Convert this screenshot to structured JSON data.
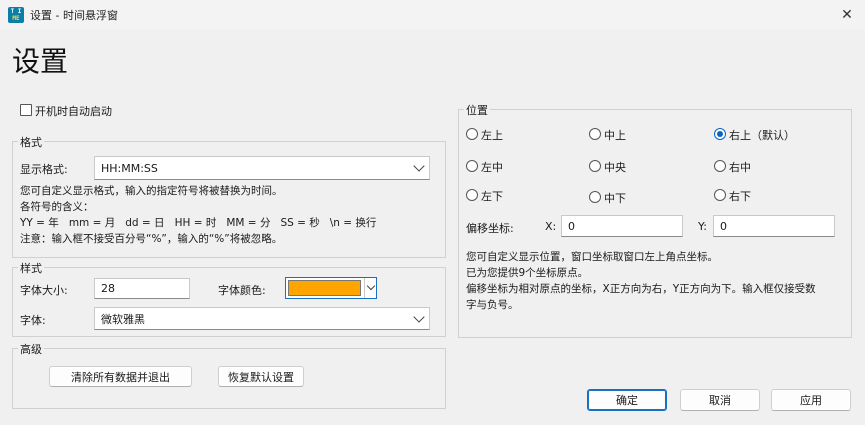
{
  "window": {
    "title": "设置 - 时间悬浮窗",
    "icon_text_top": "T I",
    "icon_text_bottom": "ME"
  },
  "page_title": "设置",
  "autostart": {
    "label": "开机时自动启动",
    "checked": false
  },
  "format_group": {
    "title": "格式",
    "display_label": "显示格式:",
    "display_value": "HH:MM:SS",
    "desc": [
      "您可自定义显示格式，输入的指定符号将被替换为时间。",
      "各符号的含义：",
      "YY = 年   mm = 月   dd = 日   HH = 时   MM = 分   SS = 秒   \\n = 换行",
      "注意：输入框不接受百分号“%”，输入的“%”将被忽略。"
    ]
  },
  "style_group": {
    "title": "样式",
    "font_size_label": "字体大小:",
    "font_size_value": "28",
    "font_color_label": "字体颜色:",
    "font_color": "#ffa500",
    "font_label": "字体:",
    "font_value": "微软雅黑"
  },
  "advanced_group": {
    "title": "高级",
    "clear_button": "清除所有数据并退出",
    "restore_button": "恢复默认设置"
  },
  "position_group": {
    "title": "位置",
    "options": [
      {
        "label": "左上",
        "checked": false
      },
      {
        "label": "中上",
        "checked": false
      },
      {
        "label": "右上（默认）",
        "checked": true
      },
      {
        "label": "左中",
        "checked": false
      },
      {
        "label": "中央",
        "checked": false
      },
      {
        "label": "右中",
        "checked": false
      },
      {
        "label": "左下",
        "checked": false
      },
      {
        "label": "中下",
        "checked": false
      },
      {
        "label": "右下",
        "checked": false
      }
    ],
    "offset_label": "偏移坐标:",
    "x_label": "X:",
    "x_value": "0",
    "y_label": "Y:",
    "y_value": "0",
    "desc": [
      "您可自定义显示位置，窗口坐标取窗口左上角点坐标。",
      "已为您提供9个坐标原点。",
      "偏移坐标为相对原点的坐标，X正方向为右，Y正方向为下。输入框仅接受数",
      "字与负号。"
    ]
  },
  "buttons": {
    "ok": "确定",
    "cancel": "取消",
    "apply": "应用"
  }
}
